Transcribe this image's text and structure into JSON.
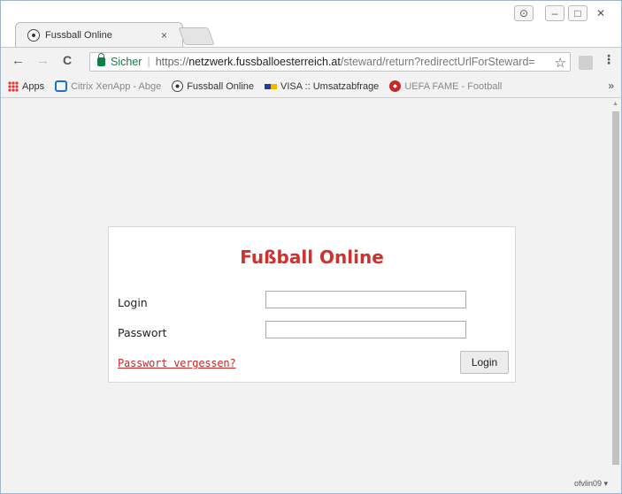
{
  "tab": {
    "title": "Fussball Online",
    "close": "×"
  },
  "window_controls": {
    "user": "⊙",
    "minimize": "–",
    "maximize": "□",
    "close": "✕"
  },
  "nav": {
    "back": "←",
    "forward": "→",
    "reload": "C"
  },
  "address": {
    "secure_label": "Sicher",
    "separator": "|",
    "protocol": "https://",
    "host": "netzwerk.fussballoesterreich.at",
    "path": "/steward/return?redirectUrlForSteward=",
    "star": "☆"
  },
  "menu": {
    "more": "⋮"
  },
  "bookmarks": {
    "items": [
      {
        "label": "Apps"
      },
      {
        "label": "Citrix XenApp - Abge"
      },
      {
        "label": "Fussball Online"
      },
      {
        "label": "VISA :: Umsatzabfrage"
      },
      {
        "label": "UEFA FAME - Football"
      }
    ],
    "more": "»"
  },
  "login": {
    "title": "Fußball Online",
    "login_label": "Login",
    "login_value": "",
    "password_label": "Passwort",
    "password_value": "",
    "forgot_link": "Passwort vergessen?",
    "submit_label": "Login"
  },
  "status": {
    "text": "ofvlin09 ▾"
  },
  "colors": {
    "brand_red": "#d2302c",
    "secure_green": "#0b8043",
    "link_red": "#c62828"
  }
}
